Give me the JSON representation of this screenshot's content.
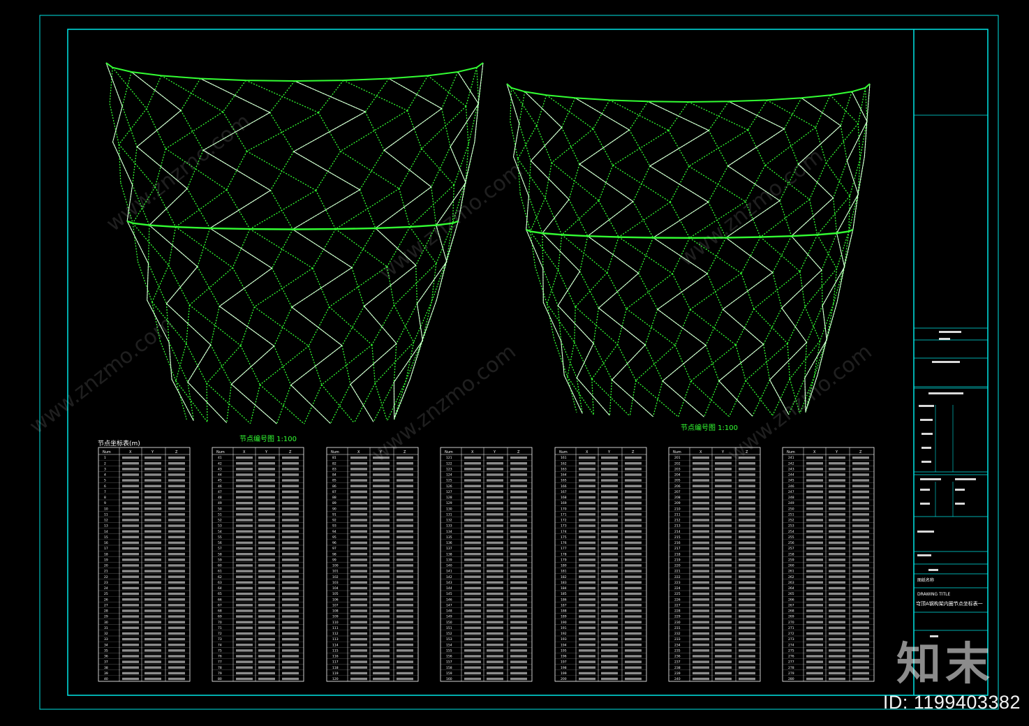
{
  "drawing": {
    "views": [
      {
        "label": "节点编号图 1:100"
      },
      {
        "label": "节点编号图 1:100"
      }
    ],
    "table_title": "节点坐标表(m)",
    "table_headers": [
      "Num",
      "X",
      "Y",
      "Z"
    ],
    "table_ranges": [
      {
        "start": 1,
        "end": 40
      },
      {
        "start": 41,
        "end": 80
      },
      {
        "start": 81,
        "end": 120
      },
      {
        "start": 121,
        "end": 160
      },
      {
        "start": 161,
        "end": 200
      },
      {
        "start": 201,
        "end": 240
      },
      {
        "start": 241,
        "end": 280
      }
    ]
  },
  "title_block": {
    "drawing_name_label": "图纸名称",
    "drawing_name_en": "DRAWING TITLE",
    "drawing_name": "穹顶A钢构架内圈节点坐标表一"
  },
  "watermark": {
    "site": "www.znzmo.com",
    "logo": "知末",
    "id": "ID: 1199403382"
  },
  "colors": {
    "frame": "#00e5e5",
    "linework": "#33ff33",
    "members": "#e8ffe8",
    "background": "#000000"
  }
}
